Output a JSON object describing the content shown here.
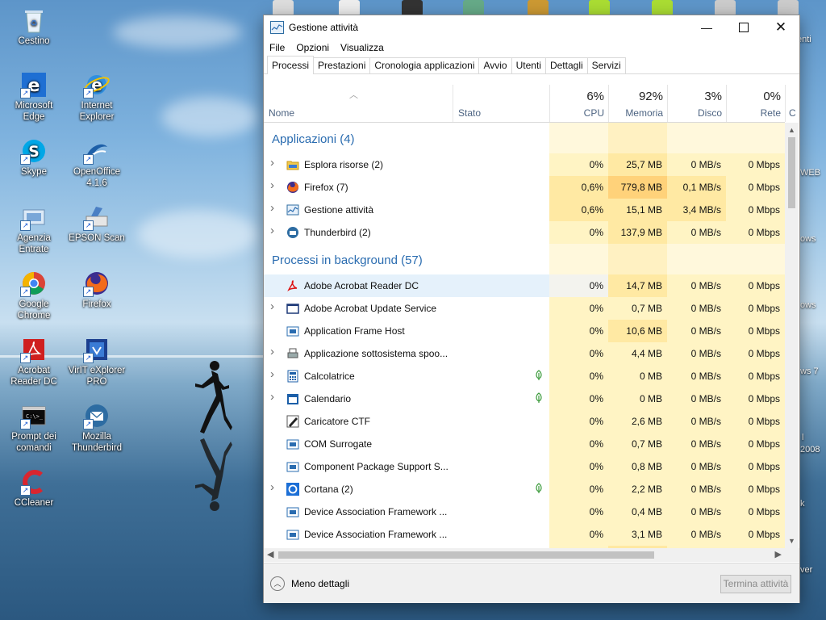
{
  "desktop": {
    "icons": [
      {
        "id": "cestino",
        "label": "Cestino"
      },
      {
        "id": "edge",
        "label": "Microsoft Edge"
      },
      {
        "id": "ie",
        "label": "Internet Explorer"
      },
      {
        "id": "skype",
        "label": "Skype"
      },
      {
        "id": "openoffice",
        "label": "OpenOffice 4.1.6"
      },
      {
        "id": "agenzia",
        "label": "Agenzia Entrate"
      },
      {
        "id": "epson",
        "label": "EPSON Scan"
      },
      {
        "id": "chrome",
        "label": "Google Chrome"
      },
      {
        "id": "firefox",
        "label": "Firefox"
      },
      {
        "id": "acrobat",
        "label": "Acrobat Reader DC"
      },
      {
        "id": "virit",
        "label": "VirIT eXplorer PRO"
      },
      {
        "id": "cmd",
        "label": "Prompt dei comandi"
      },
      {
        "id": "thunderbird",
        "label": "Mozilla Thunderbird"
      },
      {
        "id": "ccleaner",
        "label": "CCleaner"
      }
    ],
    "right_fragments": [
      "enti",
      "WEB",
      "ows",
      "ows",
      "ws 7",
      "l",
      "2008",
      "k",
      "ver"
    ]
  },
  "window": {
    "title": "Gestione attività",
    "menu": [
      "File",
      "Opzioni",
      "Visualizza"
    ],
    "tabs": [
      "Processi",
      "Prestazioni",
      "Cronologia applicazioni",
      "Avvio",
      "Utenti",
      "Dettagli",
      "Servizi"
    ],
    "active_tab": "Processi",
    "columns": {
      "name": "Nome",
      "stato": "Stato",
      "cpu": {
        "pct": "6%",
        "label": "CPU"
      },
      "mem": {
        "pct": "92%",
        "label": "Memoria"
      },
      "disk": {
        "pct": "3%",
        "label": "Disco"
      },
      "net": {
        "pct": "0%",
        "label": "Rete"
      },
      "partial": "C"
    },
    "groups": {
      "apps": "Applicazioni (4)",
      "background": "Processi in background (57)"
    },
    "apps": [
      {
        "name": "Esplora risorse (2)",
        "cpu": "0%",
        "mem": "25,7 MB",
        "disk": "0 MB/s",
        "net": "0 Mbps",
        "icon": "folder-icon"
      },
      {
        "name": "Firefox (7)",
        "cpu": "0,6%",
        "mem": "779,8 MB",
        "disk": "0,1 MB/s",
        "net": "0 Mbps",
        "icon": "firefox-icon"
      },
      {
        "name": "Gestione attività",
        "cpu": "0,6%",
        "mem": "15,1 MB",
        "disk": "3,4 MB/s",
        "net": "0 Mbps",
        "icon": "task-manager-icon"
      },
      {
        "name": "Thunderbird (2)",
        "cpu": "0%",
        "mem": "137,9 MB",
        "disk": "0 MB/s",
        "net": "0 Mbps",
        "icon": "thunderbird-icon"
      }
    ],
    "background": [
      {
        "name": "Adobe Acrobat Reader DC",
        "cpu": "0%",
        "mem": "14,7 MB",
        "disk": "0 MB/s",
        "net": "0 Mbps",
        "expand": false,
        "leaf": false,
        "icon": "acrobat-icon",
        "selected": true
      },
      {
        "name": "Adobe Acrobat Update Service",
        "cpu": "0%",
        "mem": "0,7 MB",
        "disk": "0 MB/s",
        "net": "0 Mbps",
        "expand": true,
        "leaf": false,
        "icon": "window-icon"
      },
      {
        "name": "Application Frame Host",
        "cpu": "0%",
        "mem": "10,6 MB",
        "disk": "0 MB/s",
        "net": "0 Mbps",
        "expand": false,
        "leaf": false,
        "icon": "app-frame-icon"
      },
      {
        "name": "Applicazione sottosistema spoo...",
        "cpu": "0%",
        "mem": "4,4 MB",
        "disk": "0 MB/s",
        "net": "0 Mbps",
        "expand": true,
        "leaf": false,
        "icon": "printer-icon"
      },
      {
        "name": "Calcolatrice",
        "cpu": "0%",
        "mem": "0 MB",
        "disk": "0 MB/s",
        "net": "0 Mbps",
        "expand": true,
        "leaf": true,
        "icon": "calculator-icon"
      },
      {
        "name": "Calendario",
        "cpu": "0%",
        "mem": "0 MB",
        "disk": "0 MB/s",
        "net": "0 Mbps",
        "expand": true,
        "leaf": true,
        "icon": "calendar-icon"
      },
      {
        "name": "Caricatore CTF",
        "cpu": "0%",
        "mem": "2,6 MB",
        "disk": "0 MB/s",
        "net": "0 Mbps",
        "expand": false,
        "leaf": false,
        "icon": "pen-icon"
      },
      {
        "name": "COM Surrogate",
        "cpu": "0%",
        "mem": "0,7 MB",
        "disk": "0 MB/s",
        "net": "0 Mbps",
        "expand": false,
        "leaf": false,
        "icon": "app-frame-icon"
      },
      {
        "name": "Component Package Support S...",
        "cpu": "0%",
        "mem": "0,8 MB",
        "disk": "0 MB/s",
        "net": "0 Mbps",
        "expand": false,
        "leaf": false,
        "icon": "app-frame-icon"
      },
      {
        "name": "Cortana (2)",
        "cpu": "0%",
        "mem": "2,2 MB",
        "disk": "0 MB/s",
        "net": "0 Mbps",
        "expand": true,
        "leaf": true,
        "icon": "cortana-icon"
      },
      {
        "name": "Device Association Framework ...",
        "cpu": "0%",
        "mem": "0,4 MB",
        "disk": "0 MB/s",
        "net": "0 Mbps",
        "expand": false,
        "leaf": false,
        "icon": "app-frame-icon"
      },
      {
        "name": "Device Association Framework ...",
        "cpu": "0%",
        "mem": "3,1 MB",
        "disk": "0 MB/s",
        "net": "0 Mbps",
        "expand": false,
        "leaf": false,
        "icon": "app-frame-icon"
      }
    ],
    "footer": {
      "less": "Meno dettagli",
      "end": "Termina attività"
    },
    "colors": {
      "accent": "#2a6cb0",
      "heat_low": "#fff4c4",
      "heat_mid": "#ffe9a3",
      "heat_high": "#ffd27a",
      "selected": "#e5f1fb"
    }
  }
}
